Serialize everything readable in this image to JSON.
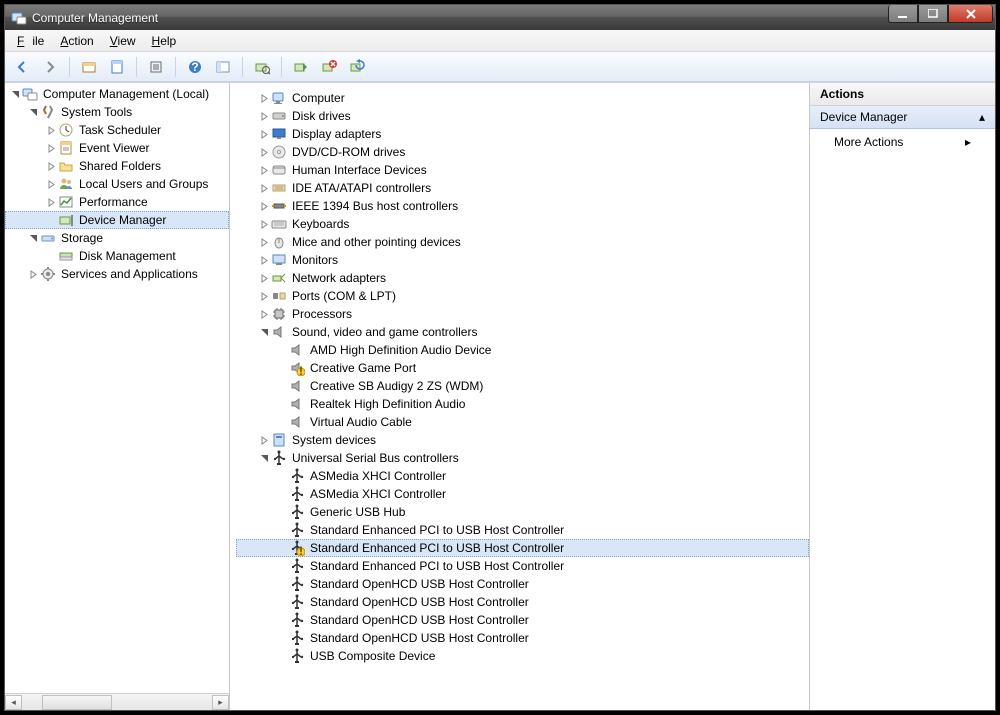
{
  "titlebar": {
    "title": "Computer Management"
  },
  "menu": {
    "file": "File",
    "action": "Action",
    "view": "View",
    "help": "Help"
  },
  "actions": {
    "header": "Actions",
    "section": "Device Manager",
    "more": "More Actions"
  },
  "leftTree": [
    {
      "d": 0,
      "exp": "open",
      "icon": "comp-mgmt",
      "label": "Computer Management (Local)"
    },
    {
      "d": 1,
      "exp": "open",
      "icon": "tools",
      "label": "System Tools"
    },
    {
      "d": 2,
      "exp": "closed",
      "icon": "scheduler",
      "label": "Task Scheduler"
    },
    {
      "d": 2,
      "exp": "closed",
      "icon": "eventviewer",
      "label": "Event Viewer"
    },
    {
      "d": 2,
      "exp": "closed",
      "icon": "sharedfolders",
      "label": "Shared Folders"
    },
    {
      "d": 2,
      "exp": "closed",
      "icon": "users",
      "label": "Local Users and Groups"
    },
    {
      "d": 2,
      "exp": "closed",
      "icon": "perf",
      "label": "Performance"
    },
    {
      "d": 2,
      "exp": "none",
      "icon": "devmgr",
      "label": "Device Manager",
      "sel": true
    },
    {
      "d": 1,
      "exp": "open",
      "icon": "storage",
      "label": "Storage"
    },
    {
      "d": 2,
      "exp": "none",
      "icon": "diskmgmt",
      "label": "Disk Management"
    },
    {
      "d": 1,
      "exp": "closed",
      "icon": "services",
      "label": "Services and Applications"
    }
  ],
  "midTree": [
    {
      "d": 0,
      "exp": "closed",
      "icon": "computer",
      "label": "Computer"
    },
    {
      "d": 0,
      "exp": "closed",
      "icon": "disk",
      "label": "Disk drives"
    },
    {
      "d": 0,
      "exp": "closed",
      "icon": "display",
      "label": "Display adapters"
    },
    {
      "d": 0,
      "exp": "closed",
      "icon": "dvd",
      "label": "DVD/CD-ROM drives"
    },
    {
      "d": 0,
      "exp": "closed",
      "icon": "hid",
      "label": "Human Interface Devices"
    },
    {
      "d": 0,
      "exp": "closed",
      "icon": "ide",
      "label": "IDE ATA/ATAPI controllers"
    },
    {
      "d": 0,
      "exp": "closed",
      "icon": "ieee1394",
      "label": "IEEE 1394 Bus host controllers"
    },
    {
      "d": 0,
      "exp": "closed",
      "icon": "keyboard",
      "label": "Keyboards"
    },
    {
      "d": 0,
      "exp": "closed",
      "icon": "mouse",
      "label": "Mice and other pointing devices"
    },
    {
      "d": 0,
      "exp": "closed",
      "icon": "monitor",
      "label": "Monitors"
    },
    {
      "d": 0,
      "exp": "closed",
      "icon": "network",
      "label": "Network adapters"
    },
    {
      "d": 0,
      "exp": "closed",
      "icon": "ports",
      "label": "Ports (COM & LPT)"
    },
    {
      "d": 0,
      "exp": "closed",
      "icon": "cpu",
      "label": "Processors"
    },
    {
      "d": 0,
      "exp": "open",
      "icon": "sound",
      "label": "Sound, video and game controllers"
    },
    {
      "d": 1,
      "exp": "none",
      "icon": "sound",
      "label": "AMD High Definition Audio Device"
    },
    {
      "d": 1,
      "exp": "none",
      "icon": "sound",
      "label": "Creative Game Port",
      "warn": true
    },
    {
      "d": 1,
      "exp": "none",
      "icon": "sound",
      "label": "Creative SB Audigy 2 ZS (WDM)"
    },
    {
      "d": 1,
      "exp": "none",
      "icon": "sound",
      "label": "Realtek High Definition Audio"
    },
    {
      "d": 1,
      "exp": "none",
      "icon": "sound",
      "label": "Virtual Audio Cable"
    },
    {
      "d": 0,
      "exp": "closed",
      "icon": "system",
      "label": "System devices"
    },
    {
      "d": 0,
      "exp": "open",
      "icon": "usb",
      "label": "Universal Serial Bus controllers"
    },
    {
      "d": 1,
      "exp": "none",
      "icon": "usb",
      "label": "ASMedia XHCI Controller"
    },
    {
      "d": 1,
      "exp": "none",
      "icon": "usb",
      "label": "ASMedia XHCI Controller"
    },
    {
      "d": 1,
      "exp": "none",
      "icon": "usb",
      "label": "Generic USB Hub"
    },
    {
      "d": 1,
      "exp": "none",
      "icon": "usb",
      "label": "Standard Enhanced PCI to USB Host Controller"
    },
    {
      "d": 1,
      "exp": "none",
      "icon": "usb",
      "label": "Standard Enhanced PCI to USB Host Controller",
      "sel": true,
      "warn": true
    },
    {
      "d": 1,
      "exp": "none",
      "icon": "usb",
      "label": "Standard Enhanced PCI to USB Host Controller"
    },
    {
      "d": 1,
      "exp": "none",
      "icon": "usb",
      "label": "Standard OpenHCD USB Host Controller"
    },
    {
      "d": 1,
      "exp": "none",
      "icon": "usb",
      "label": "Standard OpenHCD USB Host Controller"
    },
    {
      "d": 1,
      "exp": "none",
      "icon": "usb",
      "label": "Standard OpenHCD USB Host Controller"
    },
    {
      "d": 1,
      "exp": "none",
      "icon": "usb",
      "label": "Standard OpenHCD USB Host Controller"
    },
    {
      "d": 1,
      "exp": "none",
      "icon": "usb",
      "label": "USB Composite Device"
    }
  ]
}
